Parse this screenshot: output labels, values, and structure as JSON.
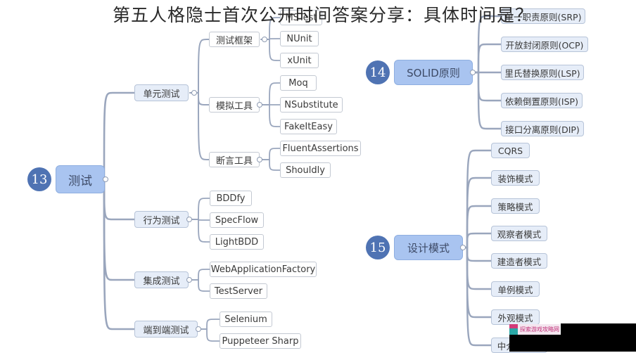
{
  "title": "第五人格隐士首次公开时间答案分享：具体时间是？",
  "colors": {
    "root_fill": "#a9c4f0",
    "branch_fill": "#e6edf8",
    "badge": "#4f73b3",
    "connector": "#9aa6bd"
  },
  "mindmaps": [
    {
      "badge": "13",
      "root": "测试",
      "branches": [
        {
          "label": "单元测试",
          "children": [
            {
              "label": "测试框架",
              "children": [
                "MSTest",
                "NUnit",
                "xUnit"
              ]
            },
            {
              "label": "模拟工具",
              "children": [
                "Moq",
                "NSubstitute",
                "FakeItEasy"
              ]
            },
            {
              "label": "断言工具",
              "children": [
                "FluentAssertions",
                "Shouldly"
              ]
            }
          ]
        },
        {
          "label": "行为测试",
          "children": [
            "BDDfy",
            "SpecFlow",
            "LightBDD"
          ]
        },
        {
          "label": "集成测试",
          "children": [
            "WebApplicationFactory",
            "TestServer"
          ]
        },
        {
          "label": "端到端测试",
          "children": [
            "Selenium",
            "Puppeteer Sharp"
          ]
        }
      ]
    },
    {
      "badge": "14",
      "root": "SOLID原则",
      "children": [
        "单一职责原则(SRP)",
        "开放封闭原则(OCP)",
        "里氏替换原则(LSP)",
        "依赖倒置原则(ISP)",
        "接口分离原则(DIP)"
      ]
    },
    {
      "badge": "15",
      "root": "设计模式",
      "children": [
        "CQRS",
        "装饰模式",
        "策略模式",
        "观察者模式",
        "建造者模式",
        "单例模式",
        "外观模式",
        "中介者模式"
      ]
    }
  ],
  "watermark": {
    "text": "探索游戏攻略网"
  }
}
